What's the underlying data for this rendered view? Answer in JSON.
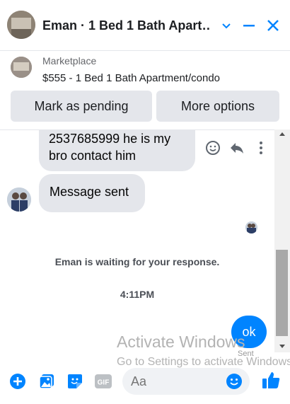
{
  "header": {
    "title": "Eman · 1 Bed 1 Bath Apart…"
  },
  "marketplace": {
    "category": "Marketplace",
    "listing": "$555 - 1 Bed 1 Bath Apartment/condo",
    "mark_pending_label": "Mark as pending",
    "more_options_label": "More options"
  },
  "messages": {
    "first": [
      "2537685999 he is my",
      "bro contact him"
    ],
    "second": "Message sent",
    "waiting": "Eman is waiting for your response.",
    "time": "4:11PM",
    "mine": "ok",
    "seen_partial": "Sent"
  },
  "watermark": {
    "line1": "Activate Windows",
    "line2": "Go to Settings to activate Windows."
  },
  "composer": {
    "placeholder": "Aa"
  },
  "colors": {
    "accent": "#0084ff",
    "bubble_grey": "#e4e6eb"
  },
  "icons": [
    "chevron-down-icon",
    "minimize-icon",
    "close-icon",
    "emoji-icon",
    "reply-icon",
    "more-icon",
    "plus-icon",
    "image-icon",
    "sticker-icon",
    "gif-icon",
    "like-icon"
  ]
}
